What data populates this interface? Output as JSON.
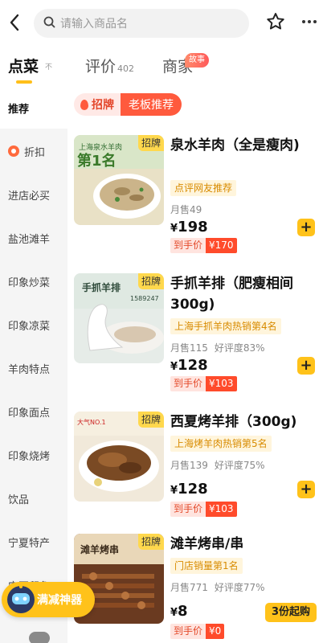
{
  "search": {
    "placeholder": "请输入商品名"
  },
  "tabs": {
    "order": {
      "label": "点菜",
      "sub": "不"
    },
    "review": {
      "label": "评价",
      "count": "402"
    },
    "merchant": {
      "label": "商家",
      "badge": "故事"
    }
  },
  "sidebar": {
    "items": [
      {
        "label": "推荐",
        "active": true
      },
      {
        "label": "折扣"
      },
      {
        "label": "进店必买"
      },
      {
        "label": "盐池滩羊"
      },
      {
        "label": "印象炒菜"
      },
      {
        "label": "印象凉菜"
      },
      {
        "label": "羊肉特点"
      },
      {
        "label": "印象面点"
      },
      {
        "label": "印象烧烤"
      },
      {
        "label": "饮品"
      },
      {
        "label": "宁夏特产"
      },
      {
        "label": "宁夏印象"
      }
    ]
  },
  "section": {
    "sign": "招牌",
    "boss": "老板推荐"
  },
  "dishes": [
    {
      "badge": "招牌",
      "name": "泉水羊肉（全是瘦肉)",
      "tag": "点评网友推荐",
      "monthly": "月售49",
      "rating": "",
      "price": "198",
      "final_label": "到手价",
      "final_price": "¥170",
      "image_text": "泉水羊肉 第1名"
    },
    {
      "badge": "招牌",
      "name": "手抓羊排（肥瘦相间300g)",
      "tag": "上海手抓羊肉热销第4名",
      "monthly": "月售115",
      "rating": "好评度83%",
      "price": "128",
      "final_label": "到手价",
      "final_price": "¥103",
      "image_text": "手抓羊排"
    },
    {
      "badge": "招牌",
      "name": "西夏烤羊排（300g)",
      "tag": "上海烤羊肉热销第5名",
      "monthly": "月售139",
      "rating": "好评度75%",
      "price": "128",
      "final_label": "到手价",
      "final_price": "¥103",
      "image_text": ""
    },
    {
      "badge": "招牌",
      "name": "滩羊烤串/串",
      "tag": "门店销量第1名",
      "monthly": "月售771",
      "rating": "好评度77%",
      "price": "8",
      "final_label": "到手价",
      "final_price": "¥0",
      "image_text": "滩羊烤串",
      "min_order": "3份起购"
    }
  ],
  "floating": {
    "label": "满减神器"
  },
  "colors": {
    "accent": "#ffc21a",
    "red": "#ff4b2b",
    "tag_text": "#d88b00"
  }
}
